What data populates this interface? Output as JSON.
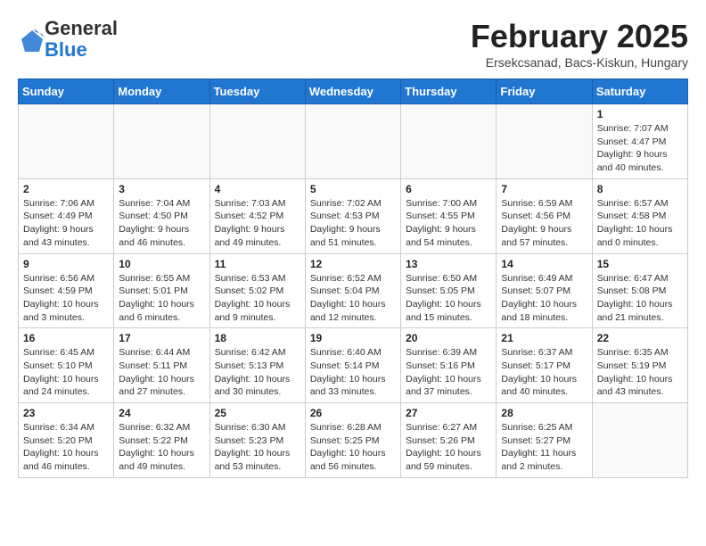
{
  "logo": {
    "general": "General",
    "blue": "Blue"
  },
  "header": {
    "month": "February 2025",
    "location": "Ersekcsanad, Bacs-Kiskun, Hungary"
  },
  "days_of_week": [
    "Sunday",
    "Monday",
    "Tuesday",
    "Wednesday",
    "Thursday",
    "Friday",
    "Saturday"
  ],
  "weeks": [
    [
      {
        "day": "",
        "info": ""
      },
      {
        "day": "",
        "info": ""
      },
      {
        "day": "",
        "info": ""
      },
      {
        "day": "",
        "info": ""
      },
      {
        "day": "",
        "info": ""
      },
      {
        "day": "",
        "info": ""
      },
      {
        "day": "1",
        "info": "Sunrise: 7:07 AM\nSunset: 4:47 PM\nDaylight: 9 hours and 40 minutes."
      }
    ],
    [
      {
        "day": "2",
        "info": "Sunrise: 7:06 AM\nSunset: 4:49 PM\nDaylight: 9 hours and 43 minutes."
      },
      {
        "day": "3",
        "info": "Sunrise: 7:04 AM\nSunset: 4:50 PM\nDaylight: 9 hours and 46 minutes."
      },
      {
        "day": "4",
        "info": "Sunrise: 7:03 AM\nSunset: 4:52 PM\nDaylight: 9 hours and 49 minutes."
      },
      {
        "day": "5",
        "info": "Sunrise: 7:02 AM\nSunset: 4:53 PM\nDaylight: 9 hours and 51 minutes."
      },
      {
        "day": "6",
        "info": "Sunrise: 7:00 AM\nSunset: 4:55 PM\nDaylight: 9 hours and 54 minutes."
      },
      {
        "day": "7",
        "info": "Sunrise: 6:59 AM\nSunset: 4:56 PM\nDaylight: 9 hours and 57 minutes."
      },
      {
        "day": "8",
        "info": "Sunrise: 6:57 AM\nSunset: 4:58 PM\nDaylight: 10 hours and 0 minutes."
      }
    ],
    [
      {
        "day": "9",
        "info": "Sunrise: 6:56 AM\nSunset: 4:59 PM\nDaylight: 10 hours and 3 minutes."
      },
      {
        "day": "10",
        "info": "Sunrise: 6:55 AM\nSunset: 5:01 PM\nDaylight: 10 hours and 6 minutes."
      },
      {
        "day": "11",
        "info": "Sunrise: 6:53 AM\nSunset: 5:02 PM\nDaylight: 10 hours and 9 minutes."
      },
      {
        "day": "12",
        "info": "Sunrise: 6:52 AM\nSunset: 5:04 PM\nDaylight: 10 hours and 12 minutes."
      },
      {
        "day": "13",
        "info": "Sunrise: 6:50 AM\nSunset: 5:05 PM\nDaylight: 10 hours and 15 minutes."
      },
      {
        "day": "14",
        "info": "Sunrise: 6:49 AM\nSunset: 5:07 PM\nDaylight: 10 hours and 18 minutes."
      },
      {
        "day": "15",
        "info": "Sunrise: 6:47 AM\nSunset: 5:08 PM\nDaylight: 10 hours and 21 minutes."
      }
    ],
    [
      {
        "day": "16",
        "info": "Sunrise: 6:45 AM\nSunset: 5:10 PM\nDaylight: 10 hours and 24 minutes."
      },
      {
        "day": "17",
        "info": "Sunrise: 6:44 AM\nSunset: 5:11 PM\nDaylight: 10 hours and 27 minutes."
      },
      {
        "day": "18",
        "info": "Sunrise: 6:42 AM\nSunset: 5:13 PM\nDaylight: 10 hours and 30 minutes."
      },
      {
        "day": "19",
        "info": "Sunrise: 6:40 AM\nSunset: 5:14 PM\nDaylight: 10 hours and 33 minutes."
      },
      {
        "day": "20",
        "info": "Sunrise: 6:39 AM\nSunset: 5:16 PM\nDaylight: 10 hours and 37 minutes."
      },
      {
        "day": "21",
        "info": "Sunrise: 6:37 AM\nSunset: 5:17 PM\nDaylight: 10 hours and 40 minutes."
      },
      {
        "day": "22",
        "info": "Sunrise: 6:35 AM\nSunset: 5:19 PM\nDaylight: 10 hours and 43 minutes."
      }
    ],
    [
      {
        "day": "23",
        "info": "Sunrise: 6:34 AM\nSunset: 5:20 PM\nDaylight: 10 hours and 46 minutes."
      },
      {
        "day": "24",
        "info": "Sunrise: 6:32 AM\nSunset: 5:22 PM\nDaylight: 10 hours and 49 minutes."
      },
      {
        "day": "25",
        "info": "Sunrise: 6:30 AM\nSunset: 5:23 PM\nDaylight: 10 hours and 53 minutes."
      },
      {
        "day": "26",
        "info": "Sunrise: 6:28 AM\nSunset: 5:25 PM\nDaylight: 10 hours and 56 minutes."
      },
      {
        "day": "27",
        "info": "Sunrise: 6:27 AM\nSunset: 5:26 PM\nDaylight: 10 hours and 59 minutes."
      },
      {
        "day": "28",
        "info": "Sunrise: 6:25 AM\nSunset: 5:27 PM\nDaylight: 11 hours and 2 minutes."
      },
      {
        "day": "",
        "info": ""
      }
    ]
  ]
}
